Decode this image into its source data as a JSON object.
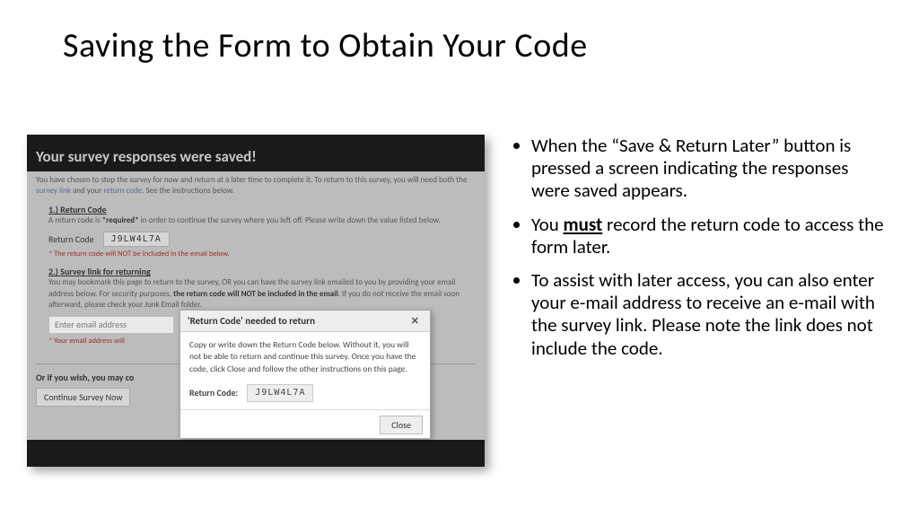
{
  "title": "Saving the Form to Obtain Your Code",
  "shot": {
    "saved_heading": "Your survey responses were saved!",
    "intro_a": "You have chosen to stop the survey for now and return at a later time to complete it. To return to this survey, you will need both the ",
    "intro_link1": "survey link",
    "intro_mid": " and your ",
    "intro_link2": "return code",
    "intro_b": ". See the instructions below.",
    "sec1_num": "1.) ",
    "sec1_title": "Return Code",
    "sec1_text_a": "A return code is ",
    "sec1_req": "*required*",
    "sec1_text_b": " in order to continue the survey where you left off. Please write down the value listed below.",
    "rc_label": "Return Code",
    "rc_value": "J9LW4L7A",
    "rc_warn": "* The return code will NOT be included in the email below.",
    "sec2_num": "2.) ",
    "sec2_title": "Survey link for returning",
    "sec2_text_a": "You may bookmark this page to return to the survey, OR you can have the survey link emailed to you by providing your email address below. For security purposes, ",
    "sec2_bold": "the return code will NOT be included in the email",
    "sec2_text_b": ". If you do not receive the email soon afterward, please check your Junk Email folder.",
    "email_placeholder": "Enter email address",
    "email_warn": "* Your email address will ",
    "or_text": "Or if you wish, you may co",
    "cont_btn": "Continue Survey Now"
  },
  "dialog": {
    "title": "'Return Code' needed to return",
    "body": "Copy or write down the Return Code below. Without it, you will not be able to return and continue this survey. Once you have the code, click Close and follow the other instructions on this page.",
    "rc_label": "Return Code:",
    "rc_value": "J9LW4L7A",
    "close": "Close"
  },
  "bullets": {
    "b1": "When the “Save & Return Later” button is pressed a screen indicating the responses were saved appears.",
    "b2a": "You ",
    "b2must": "must",
    "b2b": " record the return code to access the form later.",
    "b3": "To assist with later access, you can also enter your e-mail address to receive an e-mail with the survey link.  Please note the link does not include the code."
  }
}
